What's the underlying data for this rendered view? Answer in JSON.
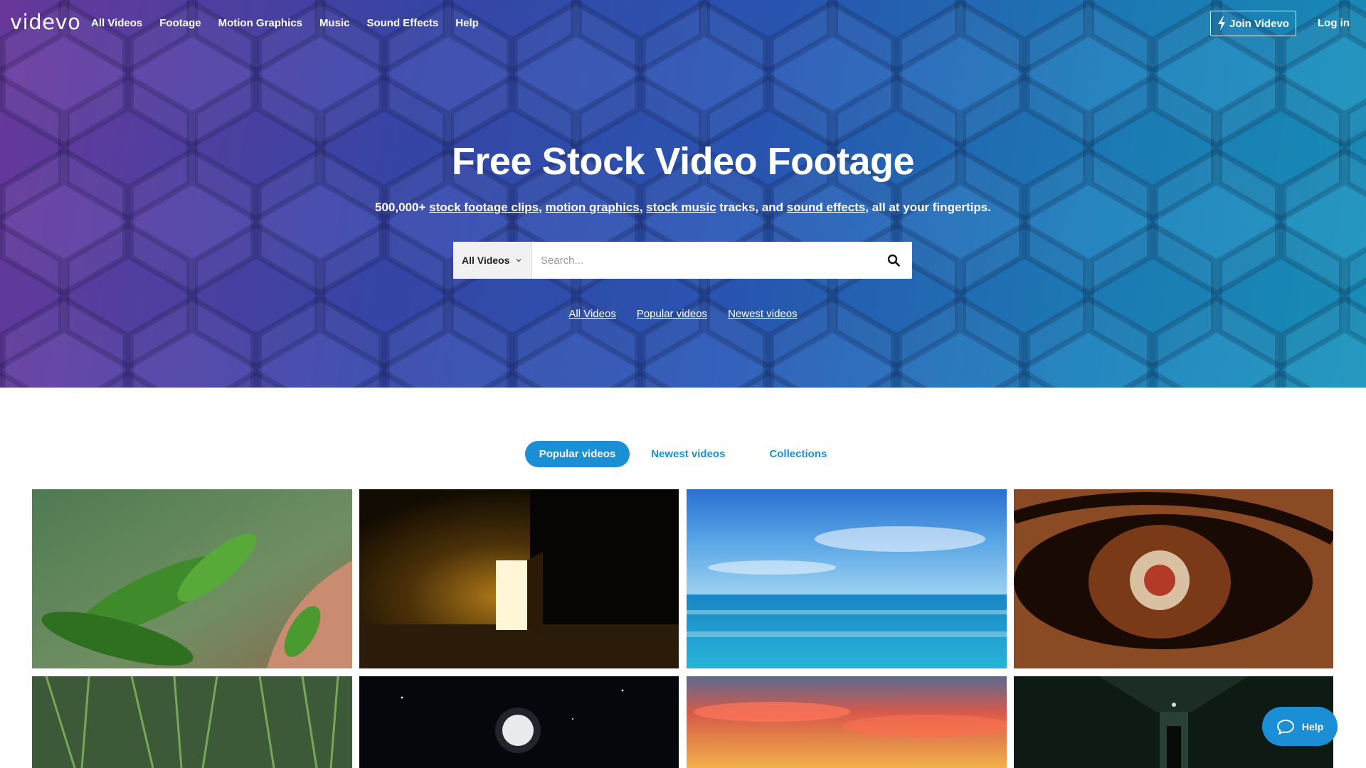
{
  "brand": {
    "logo": "videvo"
  },
  "nav": {
    "links": [
      "All Videos",
      "Footage",
      "Motion Graphics",
      "Music",
      "Sound Effects",
      "Help"
    ],
    "join": "Join Videvo",
    "login": "Log in"
  },
  "hero": {
    "title": "Free Stock Video Footage",
    "sub_prefix": "500,000+",
    "sub_link1": "stock footage clips",
    "sub_sep1": ",",
    "sub_link2": "motion graphics",
    "sub_sep2": ",",
    "sub_link3": "stock music",
    "sub_mid": "tracks, and",
    "sub_link4": "sound effects",
    "sub_suffix": ", all at your fingertips."
  },
  "search": {
    "category": "All Videos",
    "placeholder": "Search..."
  },
  "quick_links": [
    "All Videos",
    "Popular videos",
    "Newest videos"
  ],
  "tabs": [
    "Popular videos",
    "Newest videos",
    "Collections"
  ],
  "thumbnails": [
    "leaf-in-rain",
    "light-through-door",
    "ocean-and-sky",
    "eye-close-up",
    "bamboo-leaves",
    "moon-at-night",
    "sunset-clouds",
    "dark-corridor"
  ],
  "help_widget": {
    "label": "Help"
  },
  "colors": {
    "accent": "#1a8fd6"
  }
}
